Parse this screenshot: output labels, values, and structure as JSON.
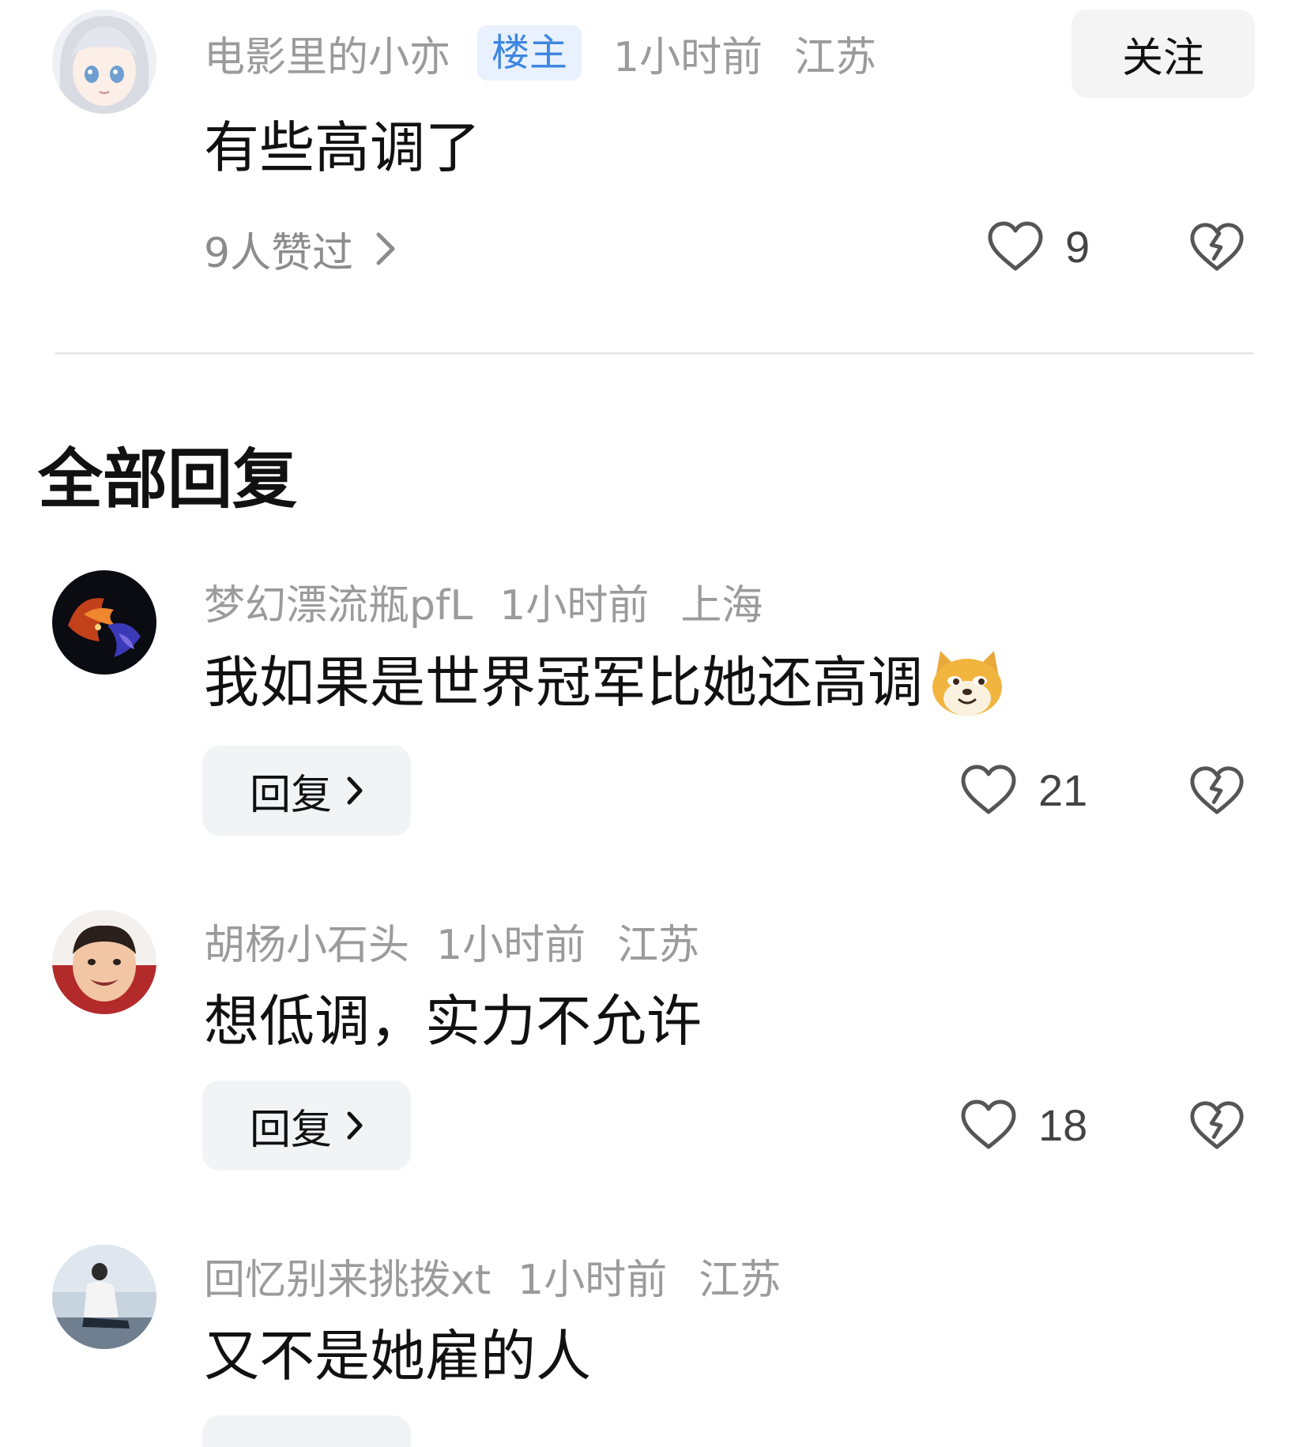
{
  "post": {
    "author": "电影里的小亦",
    "badge": "楼主",
    "time": "1小时前",
    "location": "江苏",
    "follow_label": "关注",
    "content": "有些高调了",
    "liked_by": "9人赞过",
    "like_count": "9"
  },
  "section_title": "全部回复",
  "replies": [
    {
      "author": "梦幻漂流瓶pfL",
      "time": "1小时前",
      "location": "上海",
      "content": "我如果是世界冠军比她还高调",
      "emoji": "doge-emoji",
      "reply_label": "回复",
      "like_count": "21"
    },
    {
      "author": "胡杨小石头",
      "time": "1小时前",
      "location": "江苏",
      "content": "想低调，实力不允许",
      "reply_label": "回复",
      "like_count": "18"
    },
    {
      "author": "回忆别来挑拨xt",
      "time": "1小时前",
      "location": "江苏",
      "content": "又不是她雇的人"
    }
  ],
  "icons": {
    "like": "heart-outline-icon",
    "dislike": "broken-heart-icon",
    "more": "chevron-right-icon"
  },
  "colors": {
    "meta_text": "#9b9b9b",
    "badge_bg": "#e8f1fd",
    "badge_text": "#3e86e0",
    "button_bg": "#f2f3f5"
  }
}
